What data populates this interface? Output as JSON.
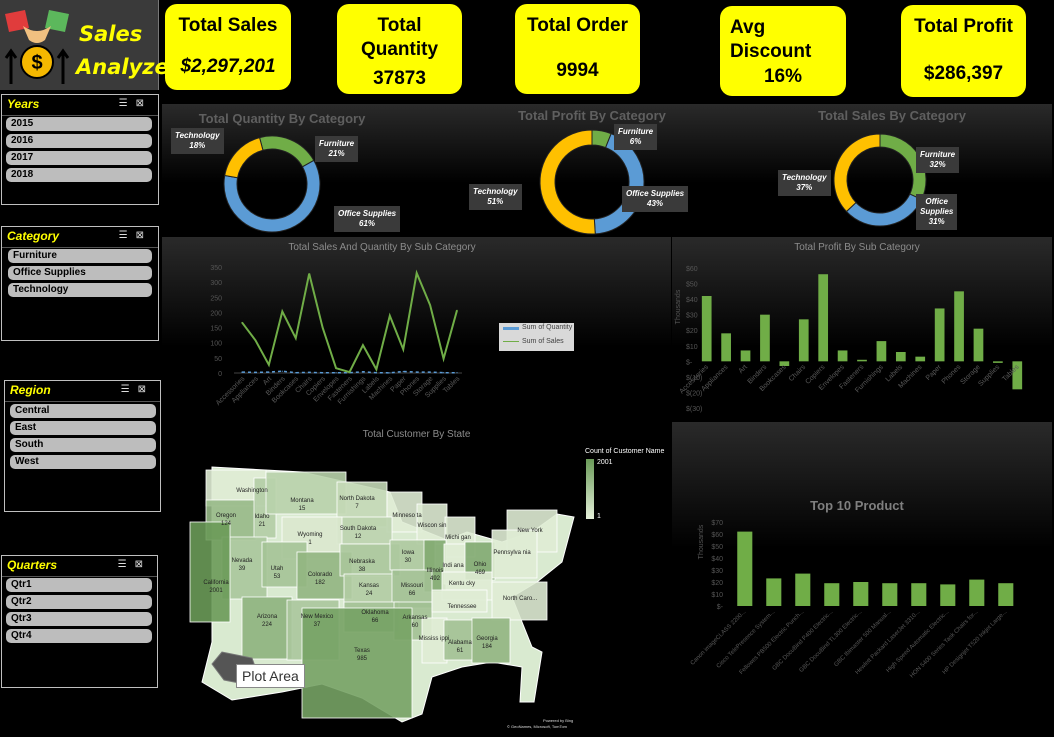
{
  "app": {
    "title_line1": "Sales",
    "title_line2": "Analyze"
  },
  "kpis": [
    {
      "title": "Total Sales",
      "value": "$2,297,201"
    },
    {
      "title": "Total Quantity",
      "value": "37873"
    },
    {
      "title": "Total Order",
      "value": "9994"
    },
    {
      "title": "Avg Discount",
      "value": "16%"
    },
    {
      "title": "Total Profit",
      "value": "$286,397"
    }
  ],
  "slicers": {
    "years": {
      "title": "Years",
      "items": [
        "2015",
        "2016",
        "2017",
        "2018"
      ]
    },
    "category": {
      "title": "Category",
      "items": [
        "Furniture",
        "Office Supplies",
        "Technology"
      ]
    },
    "region": {
      "title": "Region",
      "items": [
        "Central",
        "East",
        "South",
        "West"
      ]
    },
    "quarters": {
      "title": "Quarters",
      "items": [
        "Qtr1",
        "Qtr2",
        "Qtr3",
        "Qtr4"
      ]
    }
  },
  "colors": {
    "kpi": "#ffff00",
    "accent": "#70ad47",
    "blue": "#5b9bd5",
    "orange": "#ffc000"
  },
  "chart_data": [
    {
      "type": "pie",
      "title": "Total Quantity By Category",
      "categories": [
        "Furniture",
        "Office Supplies",
        "Technology"
      ],
      "values": [
        21,
        61,
        18
      ],
      "labels": [
        "Furniture\n21%",
        "Office Supplies\n61%",
        "Technology\n18%"
      ]
    },
    {
      "type": "pie",
      "title": "Total Profit By Category",
      "categories": [
        "Furniture",
        "Office Supplies",
        "Technology"
      ],
      "values": [
        6,
        43,
        51
      ],
      "labels": [
        "Furniture\n6%",
        "Office Supplies\n43%",
        "Technology\n51%"
      ]
    },
    {
      "type": "pie",
      "title": "Total Sales By Category",
      "categories": [
        "Furniture",
        "Office Supplies",
        "Technology"
      ],
      "values": [
        32,
        31,
        37
      ],
      "labels": [
        "Furniture\n32%",
        "Office\nSupplies\n31%",
        "Technology\n37%"
      ]
    },
    {
      "type": "line",
      "title": "Total Sales And Quantity By Sub Category",
      "categories": [
        "Accessories",
        "Appliances",
        "Art",
        "Binders",
        "Bookcases",
        "Chairs",
        "Copiers",
        "Envelopes",
        "Fasteners",
        "Furnishings",
        "Labels",
        "Machines",
        "Paper",
        "Phones",
        "Storage",
        "Supplies",
        "Tables"
      ],
      "series": [
        {
          "name": "Sum of Quantity",
          "values": [
            3,
            2,
            3,
            6,
            1,
            2,
            1,
            1,
            1,
            4,
            1,
            0.5,
            5,
            3,
            3,
            1,
            1
          ]
        },
        {
          "name": "Sum of Sales",
          "values": [
            167,
            108,
            27,
            203,
            115,
            328,
            150,
            16,
            3,
            92,
            12,
            189,
            78,
            330,
            224,
            47,
            207
          ]
        }
      ],
      "ylim": [
        0,
        350
      ],
      "yticks": [
        "0",
        "50",
        "100",
        "150",
        "200",
        "250",
        "300",
        "350"
      ]
    },
    {
      "type": "bar",
      "title": "Total Profit By Sub Category",
      "ylabel": "Thousands",
      "categories": [
        "Accessories",
        "Appliances",
        "Art",
        "Binders",
        "Bookcases",
        "Chairs",
        "Copiers",
        "Envelopes",
        "Fasteners",
        "Furnishings",
        "Labels",
        "Machines",
        "Paper",
        "Phones",
        "Storage",
        "Supplies",
        "Tables"
      ],
      "values": [
        42,
        18,
        7,
        30,
        -3,
        27,
        56,
        7,
        1,
        13,
        6,
        3,
        34,
        45,
        21,
        -1,
        -18
      ],
      "ylim": [
        -30,
        60
      ],
      "yticks": [
        "$60",
        "$50",
        "$40",
        "$30",
        "$20",
        "$10",
        "$-",
        "$(10)",
        "$(20)",
        "$(30)"
      ]
    },
    {
      "type": "bar",
      "title": "Top 10 Product",
      "ylabel": "Thousands",
      "categories": [
        "Canon imageCLASS 2200...",
        "Cisco TelePresence System...",
        "Fellowes PB500 Electric Punch...",
        "GBC DocuBind P400 Electric...",
        "GBC DocuBind TL300 Electric...",
        "GBC Ibimaster 500 Manual...",
        "Hewlett Packard LaserJet 3310...",
        "High Speed Automatic Electric...",
        "HON 5400 Series Task Chairs for...",
        "HP Designjet T520 Inkjet Large..."
      ],
      "values": [
        62,
        23,
        27,
        19,
        20,
        19,
        19,
        18,
        22,
        19
      ],
      "ylim": [
        0,
        70
      ],
      "yticks": [
        "$70",
        "$60",
        "$50",
        "$40",
        "$30",
        "$20",
        "$10",
        "$-"
      ]
    }
  ],
  "map": {
    "title": "Total Customer By State",
    "legend_title": "Count of Customer Name",
    "legend_max": "2001",
    "legend_min": "1",
    "tooltip": "Plot Area",
    "credit1": "Powered by Bing",
    "credit2": "© GeoNames, Microsoft, TomTom",
    "states": [
      [
        "Washington",
        ""
      ],
      [
        "Oregon",
        "124"
      ],
      [
        "Idaho",
        "21"
      ],
      [
        "Montana",
        "15"
      ],
      [
        "North Dakota",
        "7"
      ],
      [
        "Minneso ta",
        ""
      ],
      [
        "Wiscon sin",
        ""
      ],
      [
        "Michi gan",
        ""
      ],
      [
        "New York",
        ""
      ],
      [
        "South Dakota",
        "12"
      ],
      [
        "Wyoming",
        "1"
      ],
      [
        "Nevada",
        "39"
      ],
      [
        "Utah",
        "53"
      ],
      [
        "Colorado",
        "182"
      ],
      [
        "Nebraska",
        "38"
      ],
      [
        "Iowa",
        "30"
      ],
      [
        "Illinois",
        "492"
      ],
      [
        "Indi ana",
        ""
      ],
      [
        "Ohio",
        "469"
      ],
      [
        "Pennsylva nia",
        ""
      ],
      [
        "California",
        "2001"
      ],
      [
        "Kansas",
        "24"
      ],
      [
        "Missouri",
        "66"
      ],
      [
        "Kentu cky",
        ""
      ],
      [
        "North Caro...",
        ""
      ],
      [
        "Arizona",
        "224"
      ],
      [
        "New Mexico",
        "37"
      ],
      [
        "Oklahoma",
        "66"
      ],
      [
        "Arkansas",
        "60"
      ],
      [
        "Tennessee",
        ""
      ],
      [
        "Mississ ippi",
        ""
      ],
      [
        "Alabama",
        "61"
      ],
      [
        "Georgia",
        "184"
      ],
      [
        "Texas",
        "985"
      ]
    ]
  }
}
